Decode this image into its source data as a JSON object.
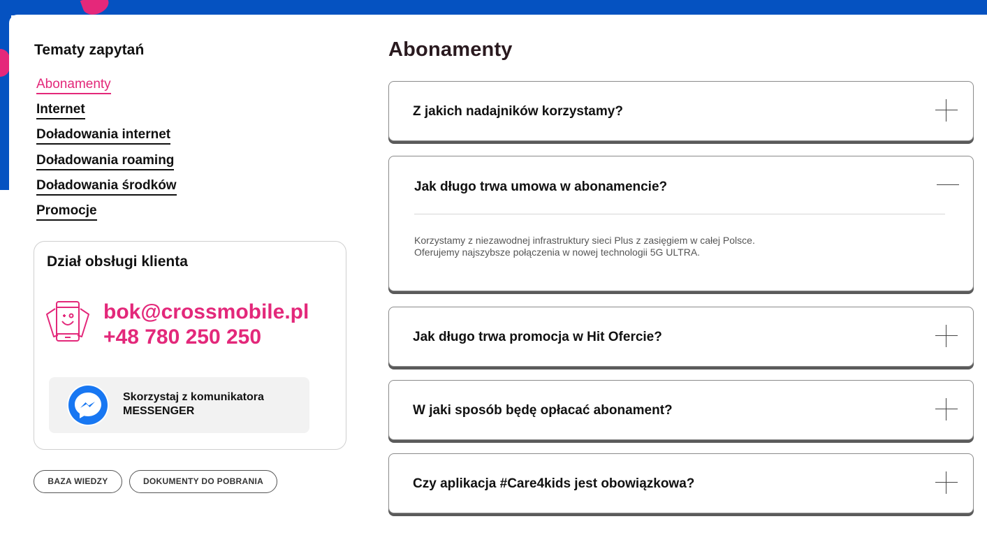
{
  "colors": {
    "brand_blue": "#0552c1",
    "brand_pink": "#e3287a"
  },
  "sidebar": {
    "title": "Tematy zapytań",
    "topics": [
      {
        "label": "Abonamenty",
        "active": true
      },
      {
        "label": "Internet"
      },
      {
        "label": "Doładowania internet"
      },
      {
        "label": "Doładowania roaming"
      },
      {
        "label": "Doładowania środków "
      },
      {
        "label": "Promocje"
      }
    ],
    "contact": {
      "title": "Dział obsługi klienta",
      "email": "bok@crossmobile.pl",
      "phone": "+48 780 250 250",
      "messenger_line1": "Skorzystaj z komunikatora",
      "messenger_line2": "MESSENGER",
      "phone_icon": "phone-smile-icon",
      "messenger_icon": "messenger-icon"
    },
    "buttons": {
      "knowledge_base": "BAZA WIEDZY",
      "documents": "DOKUMENTY DO POBRANIA"
    }
  },
  "main": {
    "title": "Abonamenty",
    "faq": [
      {
        "question": "Z jakich nadajników korzystamy?",
        "expanded": false
      },
      {
        "question": "Jak długo trwa umowa w abonamencie?",
        "expanded": true,
        "answer_line1": "Korzystamy z niezawodnej infrastruktury sieci Plus z zasięgiem w całej Polsce.",
        "answer_line2": "Oferujemy najszybsze połączenia w nowej technologii 5G ULTRA."
      },
      {
        "question": "Jak długo trwa promocja w Hit Ofercie?",
        "expanded": false
      },
      {
        "question": "W jaki sposób będę opłacać abonament?",
        "expanded": false
      },
      {
        "question": "Czy aplikacja #Care4kids jest obowiązkowa?",
        "expanded": false
      }
    ]
  }
}
